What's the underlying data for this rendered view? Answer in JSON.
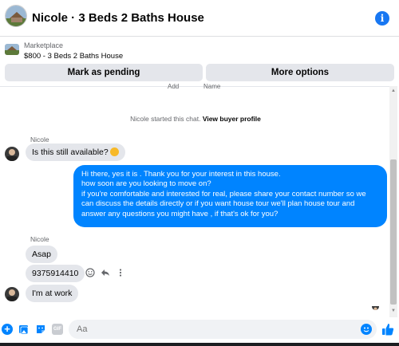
{
  "header": {
    "title": "Nicole · 3 Beds 2 Baths House",
    "info_icon": "info-icon"
  },
  "marketplace": {
    "label": "Marketplace",
    "listing": "$800 - 3 Beds 2 Baths House"
  },
  "actions": {
    "pending_label": "Mark as pending",
    "more_label": "More options"
  },
  "clipped": {
    "add": "Add",
    "name": "Name"
  },
  "chat": {
    "started_text": "Nicole started this chat.",
    "profile_link": "View buyer profile",
    "sender_1": "Nicole",
    "sender_2": "Nicole",
    "msg_available": "Is this still available?",
    "outgoing": [
      "Hi there, yes it is . Thank you for your interest in this house.",
      "how soon are you looking to move on?",
      "if you're comfortable and interested for real, please share your contact number so we",
      "can discuss the details directly or if you  want house tour we'll plan house tour and",
      "answer any questions you might have , if that's ok for you?"
    ],
    "msg_asap": "Asap",
    "msg_phone": "9375914410",
    "msg_work": "I'm at work"
  },
  "composer": {
    "placeholder": "Aa"
  },
  "colors": {
    "accent": "#0084ff",
    "brand": "#1877f2",
    "bubble_in": "#e4e6eb"
  }
}
